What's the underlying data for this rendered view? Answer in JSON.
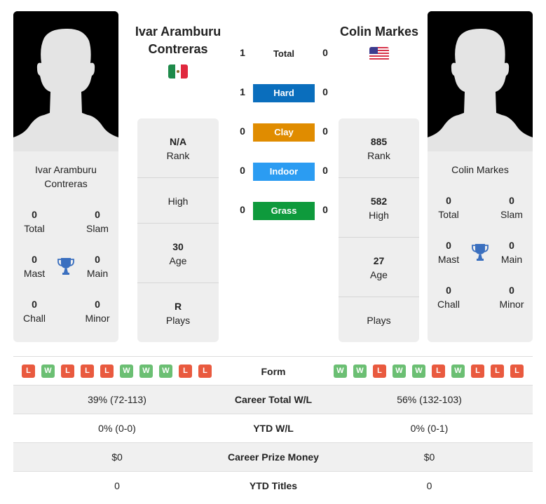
{
  "player1": {
    "name": "Ivar Aramburu Contreras",
    "name_line1": "Ivar Aramburu",
    "name_line2": "Contreras",
    "flag": "mexico-flag",
    "titles": {
      "total": {
        "value": "0",
        "label": "Total"
      },
      "slam": {
        "value": "0",
        "label": "Slam"
      },
      "mast": {
        "value": "0",
        "label": "Mast"
      },
      "main": {
        "value": "0",
        "label": "Main"
      },
      "chall": {
        "value": "0",
        "label": "Chall"
      },
      "minor": {
        "value": "0",
        "label": "Minor"
      }
    },
    "stats": {
      "rank": {
        "value": "N/A",
        "label": "Rank"
      },
      "high": {
        "value": "",
        "label": "High"
      },
      "age": {
        "value": "30",
        "label": "Age"
      },
      "plays": {
        "value": "R",
        "label": "Plays"
      }
    },
    "form": [
      "L",
      "W",
      "L",
      "L",
      "L",
      "W",
      "W",
      "W",
      "L",
      "L"
    ]
  },
  "player2": {
    "name": "Colin Markes",
    "flag": "usa-flag",
    "titles": {
      "total": {
        "value": "0",
        "label": "Total"
      },
      "slam": {
        "value": "0",
        "label": "Slam"
      },
      "mast": {
        "value": "0",
        "label": "Mast"
      },
      "main": {
        "value": "0",
        "label": "Main"
      },
      "chall": {
        "value": "0",
        "label": "Chall"
      },
      "minor": {
        "value": "0",
        "label": "Minor"
      }
    },
    "stats": {
      "rank": {
        "value": "885",
        "label": "Rank"
      },
      "high": {
        "value": "582",
        "label": "High"
      },
      "age": {
        "value": "27",
        "label": "Age"
      },
      "plays": {
        "value": "",
        "label": "Plays"
      }
    },
    "form": [
      "W",
      "W",
      "L",
      "W",
      "W",
      "L",
      "W",
      "L",
      "L",
      "L"
    ]
  },
  "h2h": {
    "total": {
      "label": "Total",
      "p1": "1",
      "p2": "0"
    },
    "surfaces": [
      {
        "label": "Hard",
        "p1": "1",
        "p2": "0",
        "color": "#0a6ebd"
      },
      {
        "label": "Clay",
        "p1": "0",
        "p2": "0",
        "color": "#e08c00"
      },
      {
        "label": "Indoor",
        "p1": "0",
        "p2": "0",
        "color": "#2b9cf2"
      },
      {
        "label": "Grass",
        "p1": "0",
        "p2": "0",
        "color": "#0e9a3c"
      }
    ]
  },
  "comparison": {
    "form_label": "Form",
    "rows": [
      {
        "label": "Career Total W/L",
        "p1": "39% (72-113)",
        "p2": "56% (132-103)"
      },
      {
        "label": "YTD W/L",
        "p1": "0% (0-0)",
        "p2": "0% (0-1)"
      },
      {
        "label": "Career Prize Money",
        "p1": "$0",
        "p2": "$0"
      },
      {
        "label": "YTD Titles",
        "p1": "0",
        "p2": "0"
      }
    ]
  },
  "colors": {
    "win": "#6bbf73",
    "loss": "#e95a3f",
    "trophy": "#3a6fbf",
    "card_bg": "#eeeeee"
  }
}
